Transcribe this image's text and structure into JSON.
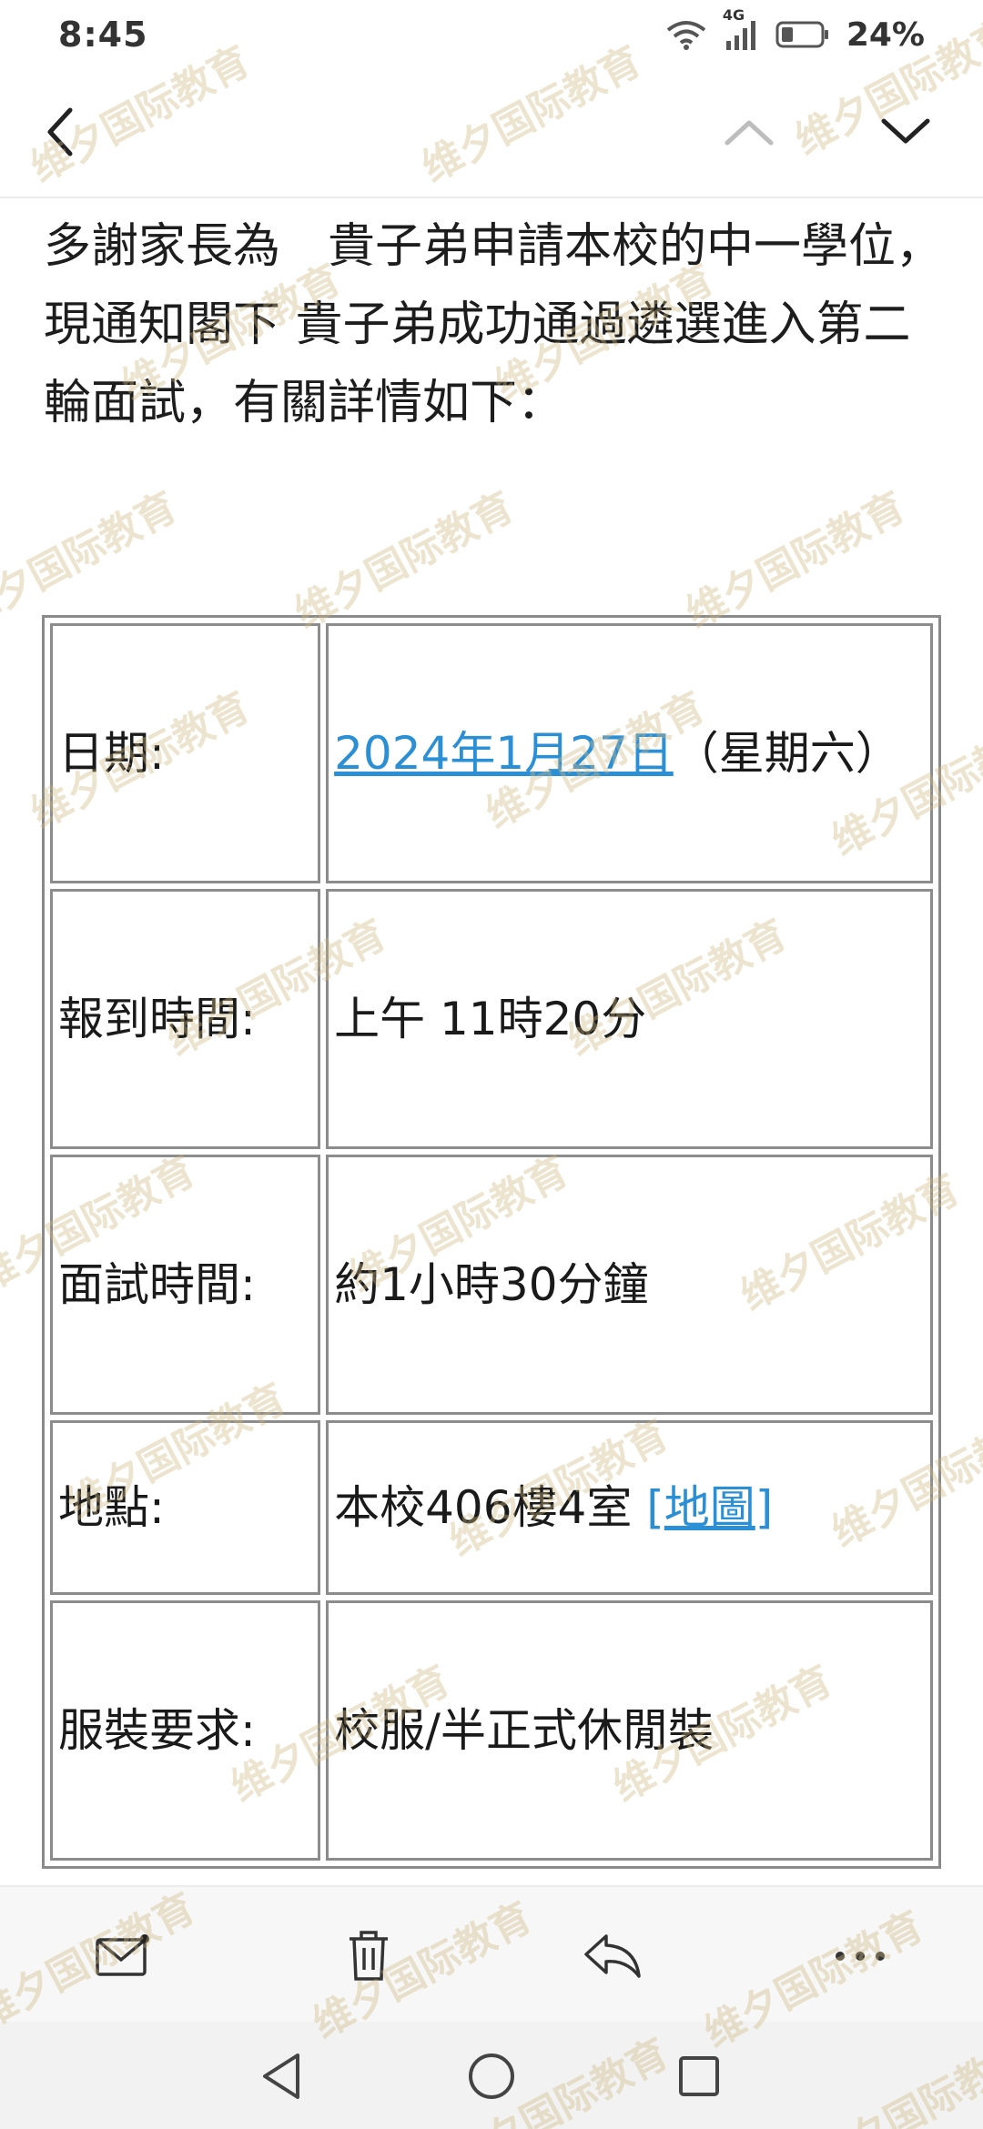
{
  "status": {
    "time": "8:45",
    "network": "4G",
    "battery": "24%"
  },
  "toolbar": {
    "back_icon": "chevron-left-icon",
    "prev_icon": "chevron-up-icon",
    "next_icon": "chevron-down-icon"
  },
  "message": {
    "intro": "多謝家長為　貴子弟申請本校的中一學位，現通知閣下 貴子弟成功通過遴選進入第二輪面試，有關詳情如下："
  },
  "details": {
    "date_label": "日期:",
    "date_link": "2024年1月27日",
    "date_suffix": "（星期六）",
    "checkin_label": "報到時間:",
    "checkin_value": "上午 11時20分",
    "duration_label": "面試時間:",
    "duration_value": "約1小時30分鐘",
    "location_label": "地點:",
    "location_value": "本校406樓4室",
    "location_bracket_open": "[",
    "location_map_link": "地圖",
    "location_bracket_close": "]",
    "dress_label": "服裝要求:",
    "dress_value": "校服/半正式休閒裝"
  },
  "actions": {
    "mail_icon": "mail-icon",
    "delete_icon": "trash-icon",
    "reply_icon": "reply-icon",
    "more_icon": "more-icon"
  },
  "watermark": "维夕国际教育",
  "colors": {
    "link": "#2b8fd6",
    "border": "#8c8c8c",
    "watermark": "#cdb982"
  }
}
